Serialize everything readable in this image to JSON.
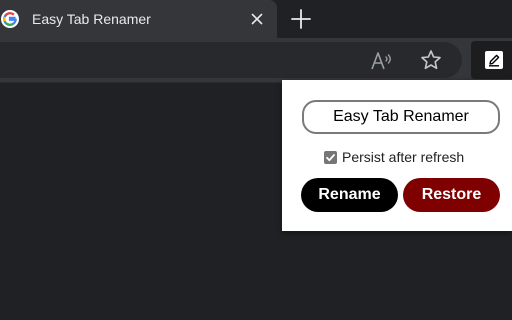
{
  "tab": {
    "title": "Easy Tab Renamer",
    "favicon": "google-g-icon"
  },
  "toolbar": {
    "icons": [
      "read-aloud-icon",
      "favorite-star-icon",
      "pen-extension-icon"
    ]
  },
  "popup": {
    "name_value": "Easy Tab Renamer",
    "persist_label": "Persist after refresh",
    "persist_checked": true,
    "rename_label": "Rename",
    "restore_label": "Restore"
  },
  "colors": {
    "background": "#202124",
    "tab_active": "#35363a",
    "rename_button": "#000000",
    "restore_button": "#7f0000"
  }
}
